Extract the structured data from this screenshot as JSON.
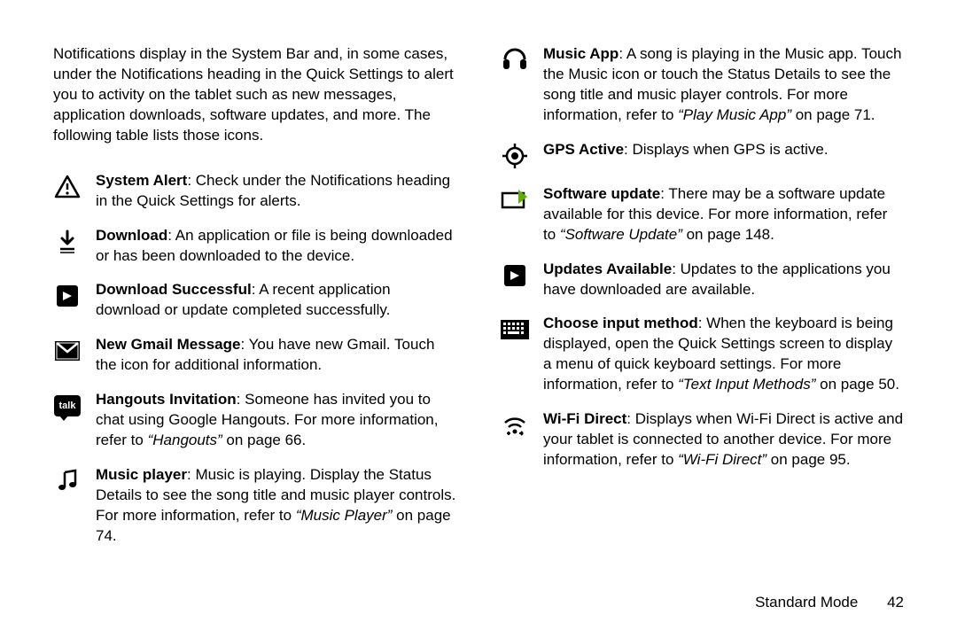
{
  "intro": "Notifications display in the System Bar and, in some cases, under the Notifications heading in the Quick Settings to alert you to activity on the tablet such as new messages, application downloads, software updates, and more. The following table lists those icons.",
  "left": [
    {
      "icon": "system-alert-icon",
      "term": "System Alert",
      "text": ": Check under the Notifications heading in the Quick Settings for alerts."
    },
    {
      "icon": "download-icon",
      "term": "Download",
      "text": ": An application or file is being downloaded or has been downloaded to the device."
    },
    {
      "icon": "download-successful-icon",
      "term": "Download Successful",
      "text": ": A recent application download or update completed successfully."
    },
    {
      "icon": "gmail-icon",
      "term": "New Gmail Message",
      "text": ": You have new Gmail. Touch the icon for additional information."
    },
    {
      "icon": "hangouts-icon",
      "term": "Hangouts Invitation",
      "text": ": Someone has invited you to chat using Google Hangouts. For more information, refer to ",
      "link": "“Hangouts”",
      "tail": " on page 66."
    },
    {
      "icon": "music-player-icon",
      "term": "Music player",
      "text": ": Music is playing. Display the Status Details to see the song title and music player controls. For more information, refer to ",
      "link": "“Music Player”",
      "tail": " on page 74."
    }
  ],
  "right": [
    {
      "icon": "music-app-icon",
      "term": "Music App",
      "text": ": A song is playing in the Music app. Touch the Music icon or touch the Status Details to see the song title and music player controls. For more information, refer to ",
      "link": "“Play Music App”",
      "tail": " on page 71."
    },
    {
      "icon": "gps-active-icon",
      "term": "GPS Active",
      "text": ": Displays when GPS is active."
    },
    {
      "icon": "software-update-icon",
      "term": "Software update",
      "text": ": There may be a software update available for this device. For more information, refer to ",
      "link": "“Software Update”",
      "tail": " on page 148."
    },
    {
      "icon": "updates-available-icon",
      "term": "Updates Available",
      "text": ": Updates to the applications you have downloaded are available."
    },
    {
      "icon": "keyboard-icon",
      "term": "Choose input method",
      "text": ": When the keyboard is being displayed, open the Quick Settings screen to display a menu of quick keyboard settings. For more information, refer to ",
      "link": "“Text Input Methods”",
      "tail": " on page 50."
    },
    {
      "icon": "wifi-direct-icon",
      "term": "Wi-Fi Direct",
      "text": ": Displays when Wi-Fi Direct is active and your tablet is connected to another device. For more information, refer to ",
      "link": "“Wi-Fi Direct”",
      "tail": " on page 95."
    }
  ],
  "footer": {
    "section": "Standard Mode",
    "page": "42"
  },
  "talk_label": "talk"
}
